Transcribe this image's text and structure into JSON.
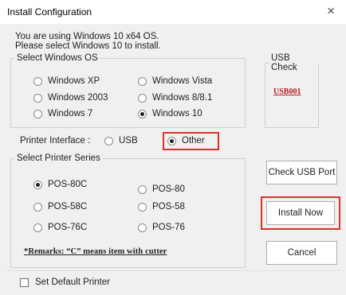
{
  "dialog": {
    "title": "Install Configuration",
    "close_glyph": "×"
  },
  "message": {
    "line1": "You are using Windows 10 x64 OS.",
    "line2": "Please select Windows 10 to install."
  },
  "windows_os": {
    "legend": "Select Windows OS",
    "options": {
      "xp": "Windows XP",
      "vista": "Windows Vista",
      "w2003": "Windows 2003",
      "w8": "Windows 8/8.1",
      "w7": "Windows 7",
      "w10": "Windows 10"
    },
    "selected": "Windows 10"
  },
  "usb_check": {
    "legend": "USB Check",
    "link_text": "USB001"
  },
  "printer_interface": {
    "label": "Printer Interface :",
    "options": {
      "usb": "USB",
      "other": "Other"
    },
    "selected": "Other"
  },
  "printer_series": {
    "legend": "Select Printer Series",
    "options": {
      "pos80c": "POS-80C",
      "pos80": "POS-80",
      "pos58c": "POS-58C",
      "pos58": "POS-58",
      "pos76c": "POS-76C",
      "pos76": "POS-76"
    },
    "selected": "POS-80C",
    "remark": "*Remarks: “C” means item with cutter"
  },
  "buttons": {
    "check_usb": "Check USB Port",
    "install": "Install Now",
    "cancel": "Cancel"
  },
  "default_printer": {
    "label": "Set Default Printer",
    "checked": false
  },
  "colors": {
    "highlight": "#d9312e",
    "link": "#b32020",
    "background": "#f0f0f0"
  },
  "icons": {
    "close": "close-icon"
  }
}
